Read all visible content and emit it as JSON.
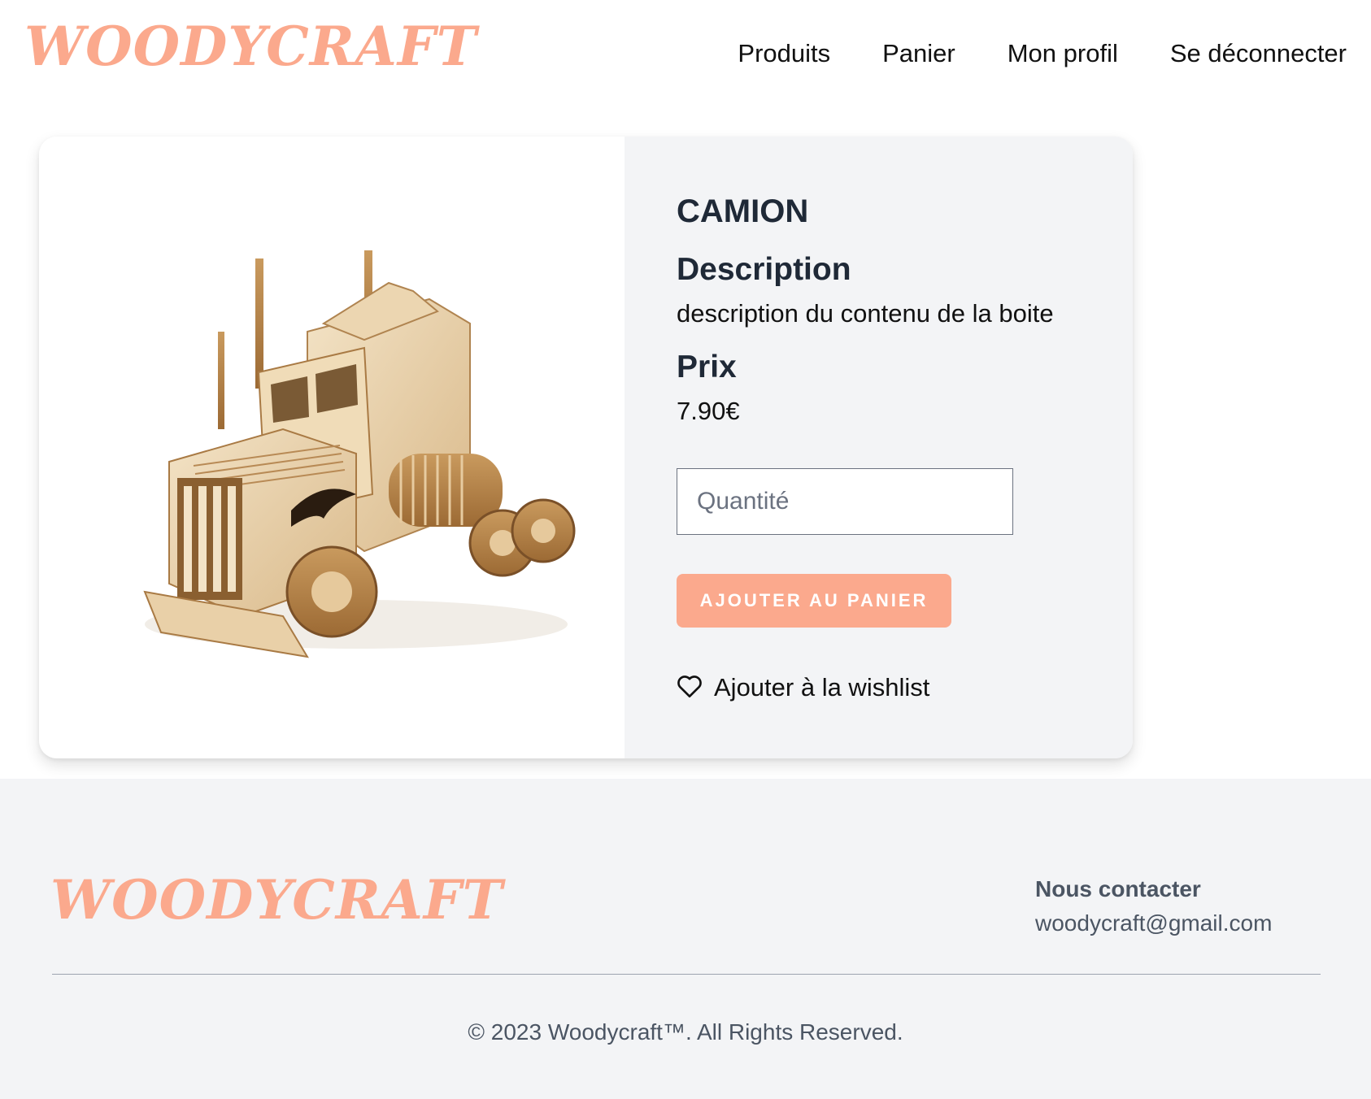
{
  "brand": {
    "name": "WOODYCRAFT",
    "accent_color": "#fba98d"
  },
  "nav": {
    "items": [
      {
        "label": "Produits"
      },
      {
        "label": "Panier"
      },
      {
        "label": "Mon profil"
      },
      {
        "label": "Se déconnecter"
      }
    ]
  },
  "product": {
    "title": "CAMION",
    "image_icon": "wooden-truck-model-image",
    "description_heading": "Description",
    "description_text": "description du contenu de la boite",
    "price_heading": "Prix",
    "price_value": "7.90€",
    "quantity_placeholder": "Quantité",
    "quantity_value": "",
    "add_to_cart_label": "AJOUTER AU PANIER",
    "wishlist_label": "Ajouter à la wishlist",
    "wishlist_icon": "heart-outline-icon"
  },
  "footer": {
    "brand": "WOODYCRAFT",
    "contact_heading": "Nous contacter",
    "contact_email": "woodycraft@gmail.com",
    "copyright": "© 2023 Woodycraft™. All Rights Reserved."
  }
}
